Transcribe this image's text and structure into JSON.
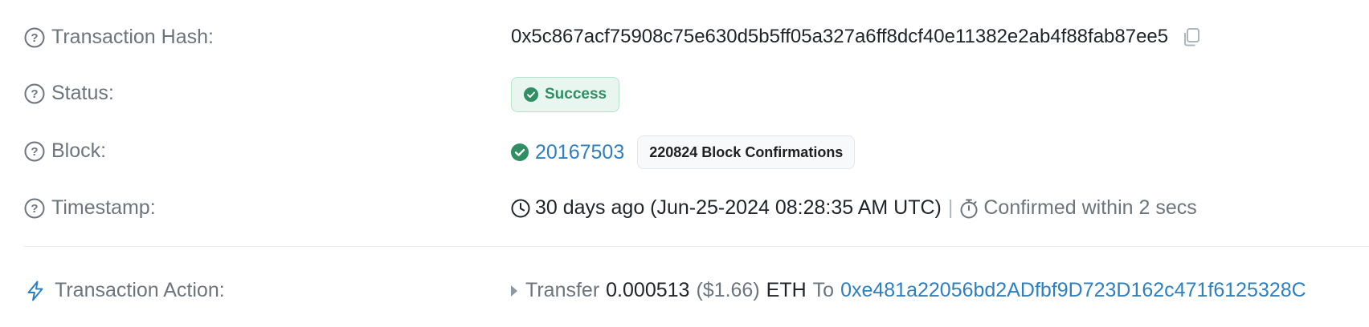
{
  "rows": {
    "hash": {
      "label": "Transaction Hash:",
      "value": "0x5c867acf75908c75e630d5b5ff05a327a6ff8dcf40e11382e2ab4f88fab87ee5"
    },
    "status": {
      "label": "Status:",
      "value": "Success"
    },
    "block": {
      "label": "Block:",
      "number": "20167503",
      "confirmations": "220824 Block Confirmations"
    },
    "timestamp": {
      "label": "Timestamp:",
      "value": "30 days ago (Jun-25-2024 08:28:35 AM UTC)",
      "separator": "|",
      "confirmed": "Confirmed within 2 secs"
    },
    "action": {
      "label": "Transaction Action:",
      "verb": "Transfer",
      "amount": "0.000513",
      "usd": "($1.66)",
      "token": "ETH",
      "to_word": "To",
      "to_address": "0xe481a22056bd2ADfbf9D723D162c471f6125328C"
    }
  },
  "colors": {
    "link": "#2e7fc0",
    "success": "#2f8f62",
    "success_bg": "#e9f6f0",
    "muted": "#6c757d"
  },
  "icons": {
    "help": "question-circle-icon",
    "copy": "copy-icon",
    "check": "check-circle-icon",
    "clock": "clock-icon",
    "stopwatch": "stopwatch-icon",
    "lightning": "lightning-icon"
  }
}
